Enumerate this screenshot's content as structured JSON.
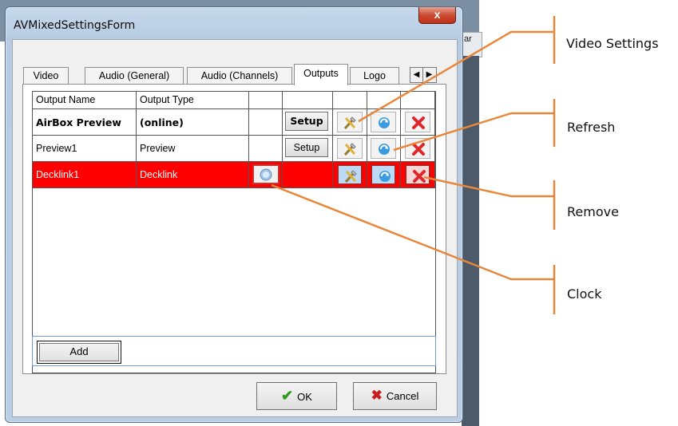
{
  "background": {
    "partial_text": "ar"
  },
  "window": {
    "title": "AVMixedSettingsForm",
    "close_label": "x"
  },
  "tabs": [
    {
      "label": "Video"
    },
    {
      "label": "Audio (General)"
    },
    {
      "label": "Audio (Channels)"
    },
    {
      "label": "Outputs",
      "active": true
    },
    {
      "label": "Logo"
    }
  ],
  "grid": {
    "columns": [
      "Output Name",
      "Output Type",
      "",
      "",
      "",
      "",
      ""
    ],
    "rows": [
      {
        "name": "AirBox Preview",
        "type": "(online)",
        "setup": "Setup",
        "bold": true
      },
      {
        "name": "Preview1",
        "type": "Preview",
        "setup": "Setup",
        "bold": false
      },
      {
        "name": "Decklink1",
        "type": "Decklink",
        "setup": "",
        "bold": false,
        "error": true
      }
    ]
  },
  "buttons": {
    "add": "Add",
    "ok": "OK",
    "cancel": "Cancel"
  },
  "annotations": {
    "video_settings": "Video Settings",
    "refresh": "Refresh",
    "remove": "Remove",
    "clock": "Clock"
  },
  "colors": {
    "error_row": "#ff0000",
    "callout_line": "#e8873b"
  },
  "icons": [
    "tools-icon",
    "refresh-icon",
    "remove-icon",
    "clock-icon"
  ]
}
